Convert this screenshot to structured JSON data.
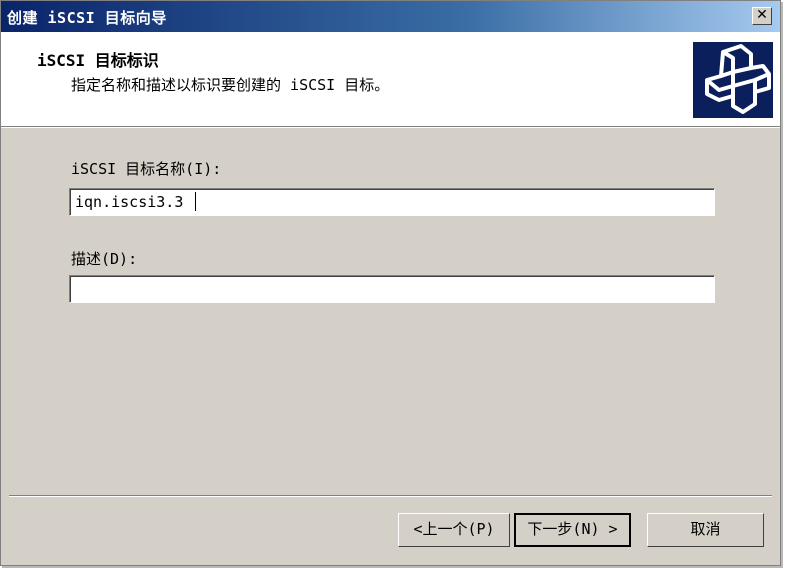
{
  "window": {
    "title": "创建 iSCSI 目标向导",
    "close_glyph": "✕"
  },
  "header": {
    "title": "iSCSI 目标标识",
    "subtitle": "指定名称和描述以标识要创建的 iSCSI 目标。",
    "logo_icon": "wizard-cross-icon"
  },
  "form": {
    "name_label": "iSCSI 目标名称(I):",
    "name_value": "iqn.iscsi3.3",
    "description_label": "描述(D):",
    "description_value": ""
  },
  "buttons": {
    "back": "<上一个(P)",
    "next": "下一步(N) >",
    "cancel": "取消"
  },
  "colors": {
    "title_bar_start": "#0a246a",
    "title_bar_end": "#a6caf0",
    "face": "#d4d0c8",
    "logo_bg": "#0a1f5c"
  }
}
